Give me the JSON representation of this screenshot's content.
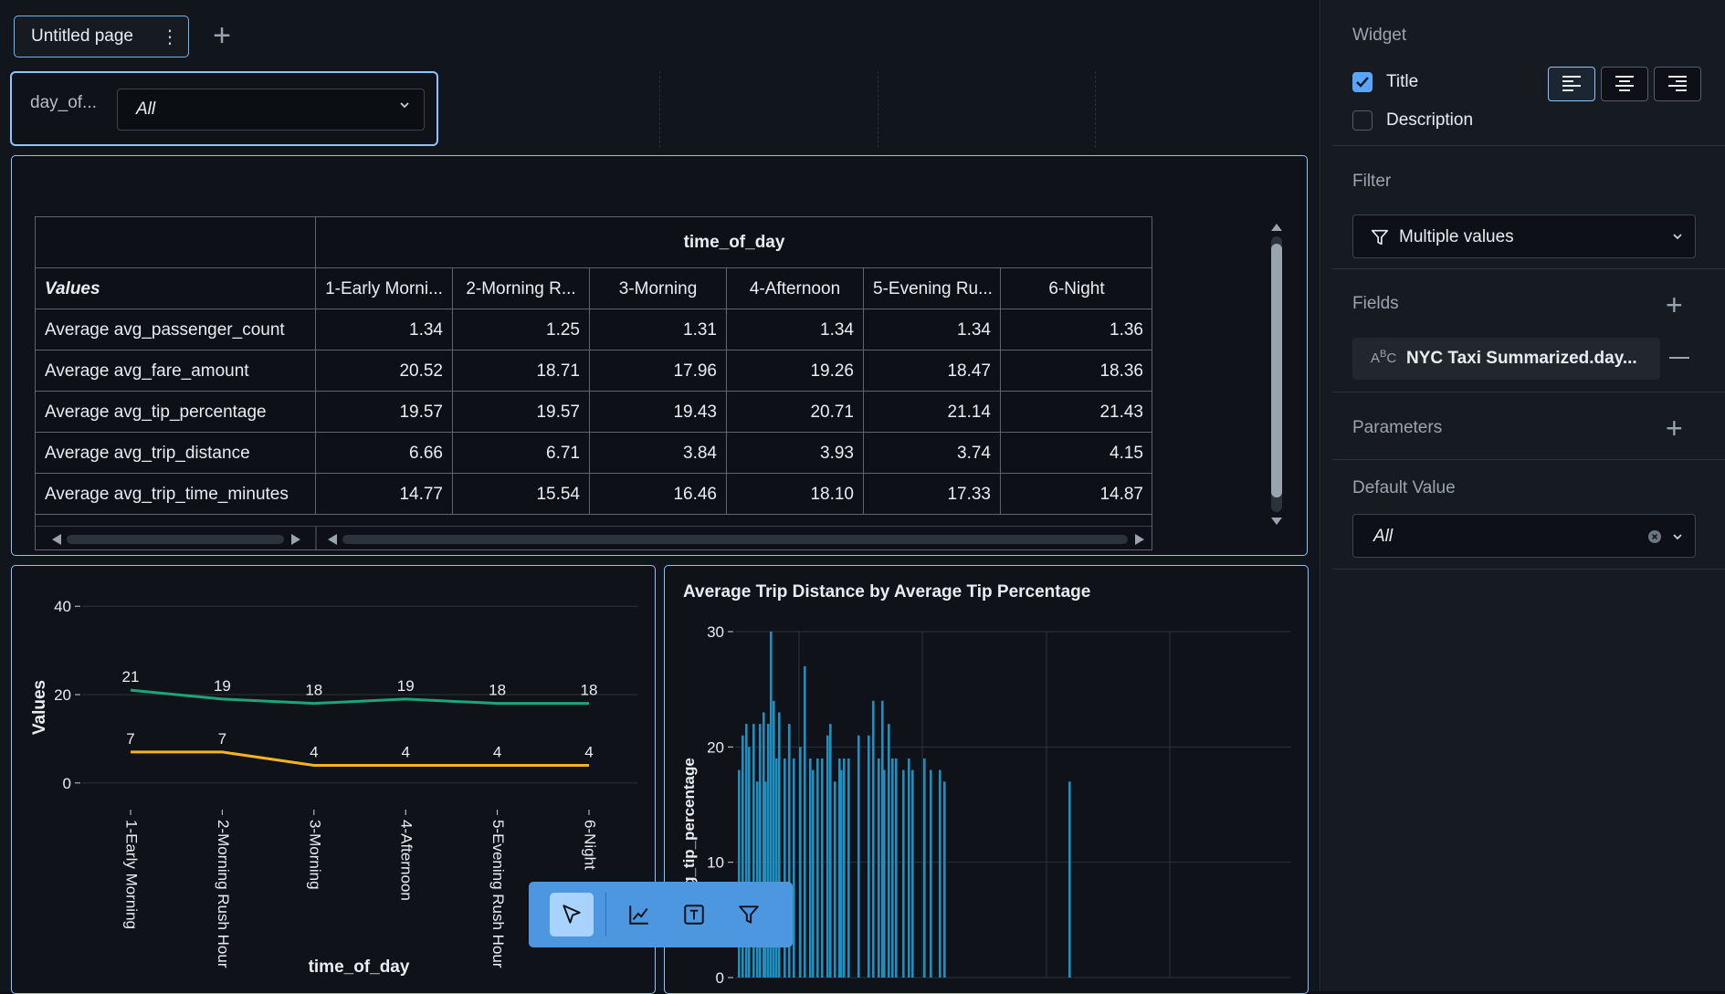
{
  "page_tab": {
    "label": "Untitled page"
  },
  "filter": {
    "label": "day_of...",
    "value": "All"
  },
  "pivot": {
    "column_group_header": "time_of_day",
    "row_header": "Values",
    "columns": [
      "1-Early Morni...",
      "2-Morning R...",
      "3-Morning",
      "4-Afternoon",
      "5-Evening Ru...",
      "6-Night"
    ],
    "rows": [
      {
        "label": "Average avg_passenger_count",
        "values": [
          "1.34",
          "1.25",
          "1.31",
          "1.34",
          "1.34",
          "1.36"
        ]
      },
      {
        "label": "Average avg_fare_amount",
        "values": [
          "20.52",
          "18.71",
          "17.96",
          "19.26",
          "18.47",
          "18.36"
        ]
      },
      {
        "label": "Average avg_tip_percentage",
        "values": [
          "19.57",
          "19.57",
          "19.43",
          "20.71",
          "21.14",
          "21.43"
        ]
      },
      {
        "label": "Average avg_trip_distance",
        "values": [
          "6.66",
          "6.71",
          "3.84",
          "3.93",
          "3.74",
          "4.15"
        ]
      },
      {
        "label": "Average avg_trip_time_minutes",
        "values": [
          "14.77",
          "15.54",
          "16.46",
          "18.10",
          "17.33",
          "14.87"
        ]
      }
    ]
  },
  "chart_data": [
    {
      "type": "line",
      "xlabel": "time_of_day",
      "ylabel": "Values",
      "categories": [
        "1-Early Morning",
        "2-Morning Rush Hour",
        "3-Morning",
        "4-Afternoon",
        "5-Evening Rush Hour",
        "6-Night"
      ],
      "ylim": [
        -5,
        45
      ],
      "yticks": [
        0,
        20,
        40
      ],
      "series": [
        {
          "values": [
            21,
            19,
            18,
            19,
            18,
            18
          ],
          "color": "#1fa37a"
        },
        {
          "values": [
            7,
            7,
            4,
            4,
            4,
            4
          ],
          "color": "#f5b324"
        }
      ],
      "grid": true
    },
    {
      "type": "bar",
      "title": "Average Trip Distance by Average Tip Percentage",
      "ylabel": "avg_tip_percentage",
      "ylim": [
        0,
        30
      ],
      "yticks": [
        0,
        10,
        20,
        30
      ],
      "color": "#1f8fc0",
      "values": [
        18,
        21,
        22,
        20,
        22,
        17,
        22,
        23,
        17,
        22,
        30,
        24,
        19,
        23,
        19,
        22,
        19,
        20,
        27,
        19,
        18,
        19,
        19,
        21,
        22,
        17,
        19,
        19,
        19,
        21,
        21,
        24,
        19,
        24,
        18,
        22,
        19,
        19,
        18,
        19,
        18,
        19,
        18,
        18,
        17
      ],
      "grid": true
    }
  ],
  "toolbar": {
    "items": [
      "pointer-icon",
      "chart-icon",
      "text-icon",
      "filter-icon"
    ]
  },
  "panel": {
    "widget_title": "Widget",
    "title_label": "Title",
    "title_checked": true,
    "description_label": "Description",
    "description_checked": false,
    "filter_title": "Filter",
    "filter_type": "Multiple values",
    "fields_title": "Fields",
    "field_name": "NYC Taxi Summarized.day...",
    "parameters_title": "Parameters",
    "default_value_title": "Default Value",
    "default_value": "All"
  }
}
